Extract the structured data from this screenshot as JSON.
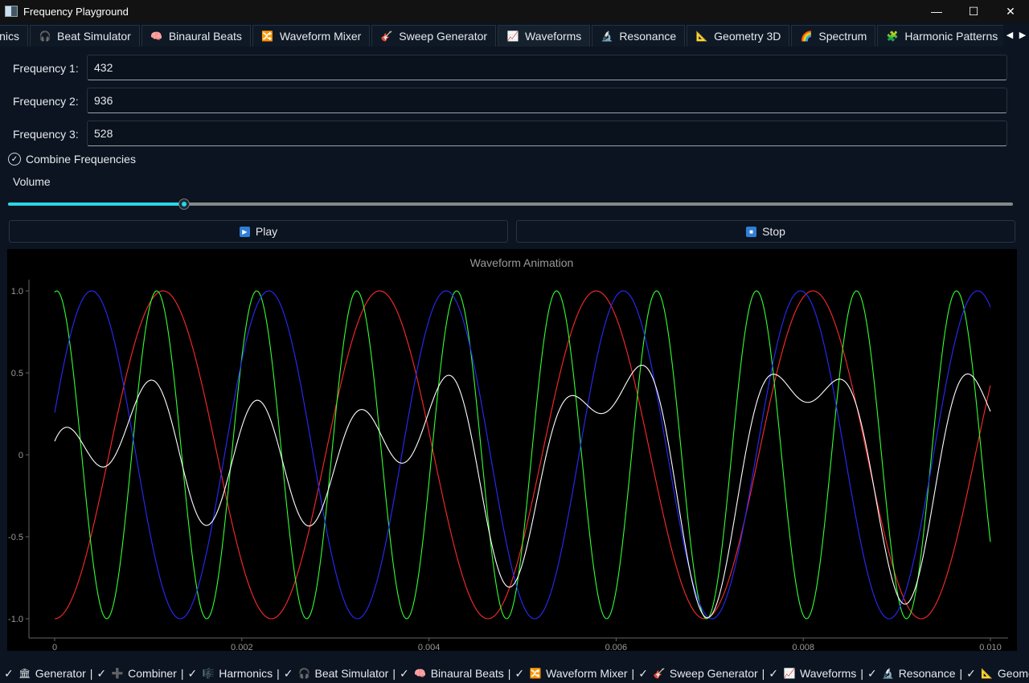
{
  "window": {
    "title": "Frequency Playground",
    "minimize": "—",
    "maximize": "☐",
    "close": "✕"
  },
  "tabs": [
    {
      "label": "rmonics",
      "icon": "",
      "name": "tab-harmonics"
    },
    {
      "label": "Beat Simulator",
      "icon": "🎧",
      "name": "tab-beat-simulator"
    },
    {
      "label": "Binaural Beats",
      "icon": "🧠",
      "name": "tab-binaural-beats"
    },
    {
      "label": "Waveform Mixer",
      "icon": "🔀",
      "name": "tab-waveform-mixer"
    },
    {
      "label": "Sweep Generator",
      "icon": "🎸",
      "name": "tab-sweep-generator"
    },
    {
      "label": "Waveforms",
      "icon": "📈",
      "name": "tab-waveforms"
    },
    {
      "label": "Resonance",
      "icon": "🔬",
      "name": "tab-resonance"
    },
    {
      "label": "Geometry 3D",
      "icon": "📐",
      "name": "tab-geometry-3d"
    },
    {
      "label": "Spectrum",
      "icon": "🌈",
      "name": "tab-spectrum"
    },
    {
      "label": "Harmonic Patterns",
      "icon": "🧩",
      "name": "tab-harmonic-patterns"
    }
  ],
  "tab_arrows": {
    "left": "◀",
    "right": "▶"
  },
  "fields": {
    "f1": {
      "label": "Frequency 1:",
      "value": "432"
    },
    "f2": {
      "label": "Frequency 2:",
      "value": "936"
    },
    "f3": {
      "label": "Frequency 3:",
      "value": "528"
    }
  },
  "combine": {
    "label": "Combine Frequencies",
    "checked": true,
    "mark": "✓"
  },
  "volume": {
    "label": "Volume",
    "level": 0.175
  },
  "buttons": {
    "play": "Play",
    "play_icon": "▶",
    "stop": "Stop",
    "stop_icon": "■"
  },
  "chart_data": {
    "type": "line",
    "title": "Waveform Animation",
    "xlim": [
      0,
      0.01
    ],
    "ylim": [
      -1.0,
      1.0
    ],
    "x_ticks": [
      "0",
      "0.002",
      "0.004",
      "0.006",
      "0.008",
      "0.010"
    ],
    "y_ticks": [
      "1.0",
      "0.5",
      "0",
      "-0.5",
      "-1.0"
    ],
    "grid": false,
    "legend": "none",
    "series": [
      {
        "frequency": 432,
        "color": "#ff2a2a",
        "phase": 4.71
      },
      {
        "frequency": 936,
        "color": "#33ff33",
        "phase": 1.44
      },
      {
        "frequency": 528,
        "color": "#2a2aff",
        "phase": 0.26
      },
      {
        "combined": true,
        "color": "#ffffff"
      }
    ]
  },
  "statusbar": [
    {
      "label": "Generator",
      "icon": "🏛"
    },
    {
      "label": "Combiner",
      "icon": "➕"
    },
    {
      "label": "Harmonics",
      "icon": "🎼"
    },
    {
      "label": "Beat Simulator",
      "icon": "🎧"
    },
    {
      "label": "Binaural Beats",
      "icon": "🧠"
    },
    {
      "label": "Waveform Mixer",
      "icon": "🔀"
    },
    {
      "label": "Sweep Generator",
      "icon": "🎸"
    },
    {
      "label": "Waveforms",
      "icon": "📈"
    },
    {
      "label": "Resonance",
      "icon": "🔬"
    },
    {
      "label": "Geometr",
      "icon": "📐"
    }
  ],
  "statusbar_check": "✓",
  "statusbar_sep": "|"
}
